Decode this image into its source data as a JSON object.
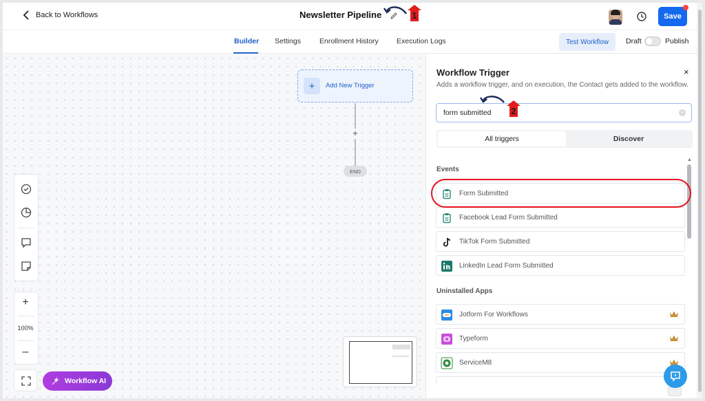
{
  "header": {
    "back_label": "Back to Workflows",
    "workflow_name": "Newsletter Pipeline",
    "save_label": "Save",
    "annotation_1": "1"
  },
  "tabs": [
    {
      "label": "Builder",
      "active": true
    },
    {
      "label": "Settings"
    },
    {
      "label": "Enrollment History"
    },
    {
      "label": "Execution Logs"
    }
  ],
  "actions": {
    "test_label": "Test Workflow",
    "draft_label": "Draft",
    "publish_label": "Publish",
    "publish_on": false
  },
  "canvas": {
    "add_trigger_label": "Add New Trigger",
    "add_step_label": "+",
    "end_label": "END",
    "zoom_level": "100%",
    "zoom_in_label": "+",
    "zoom_out_label": "–",
    "ai_button_label": "Workflow AI"
  },
  "trigger_panel": {
    "title": "Workflow Trigger",
    "close_label": "×",
    "description": "Adds a workflow trigger, and on execution, the Contact gets added to the workflow.",
    "search_value": "form submitted",
    "annotation_2": "2",
    "segments": [
      "All triggers",
      "Discover"
    ],
    "events_heading": "Events",
    "events": [
      {
        "label": "Form Submitted",
        "icon": "clipboard-icon"
      },
      {
        "label": "Facebook Lead Form Submitted",
        "icon": "clipboard-icon"
      },
      {
        "label": "TikTok Form Submitted",
        "icon": "tiktok-icon"
      },
      {
        "label": "LinkedIn Lead Form Submitted",
        "icon": "linkedin-icon"
      }
    ],
    "apps_heading": "Uninstalled Apps",
    "apps": [
      {
        "label": "Jotform For Workflows",
        "icon": "jotform-icon"
      },
      {
        "label": "Typeform",
        "icon": "typeform-icon"
      },
      {
        "label": "ServiceM8",
        "icon": "servicem8-icon"
      }
    ]
  },
  "colors": {
    "primary": "#1569ef",
    "link": "#1f5fc8",
    "highlight_ring": "#e4121d",
    "ai_gradient_start": "#b13de0",
    "ai_gradient_end": "#8a39d6",
    "crown": "#c9913a"
  }
}
